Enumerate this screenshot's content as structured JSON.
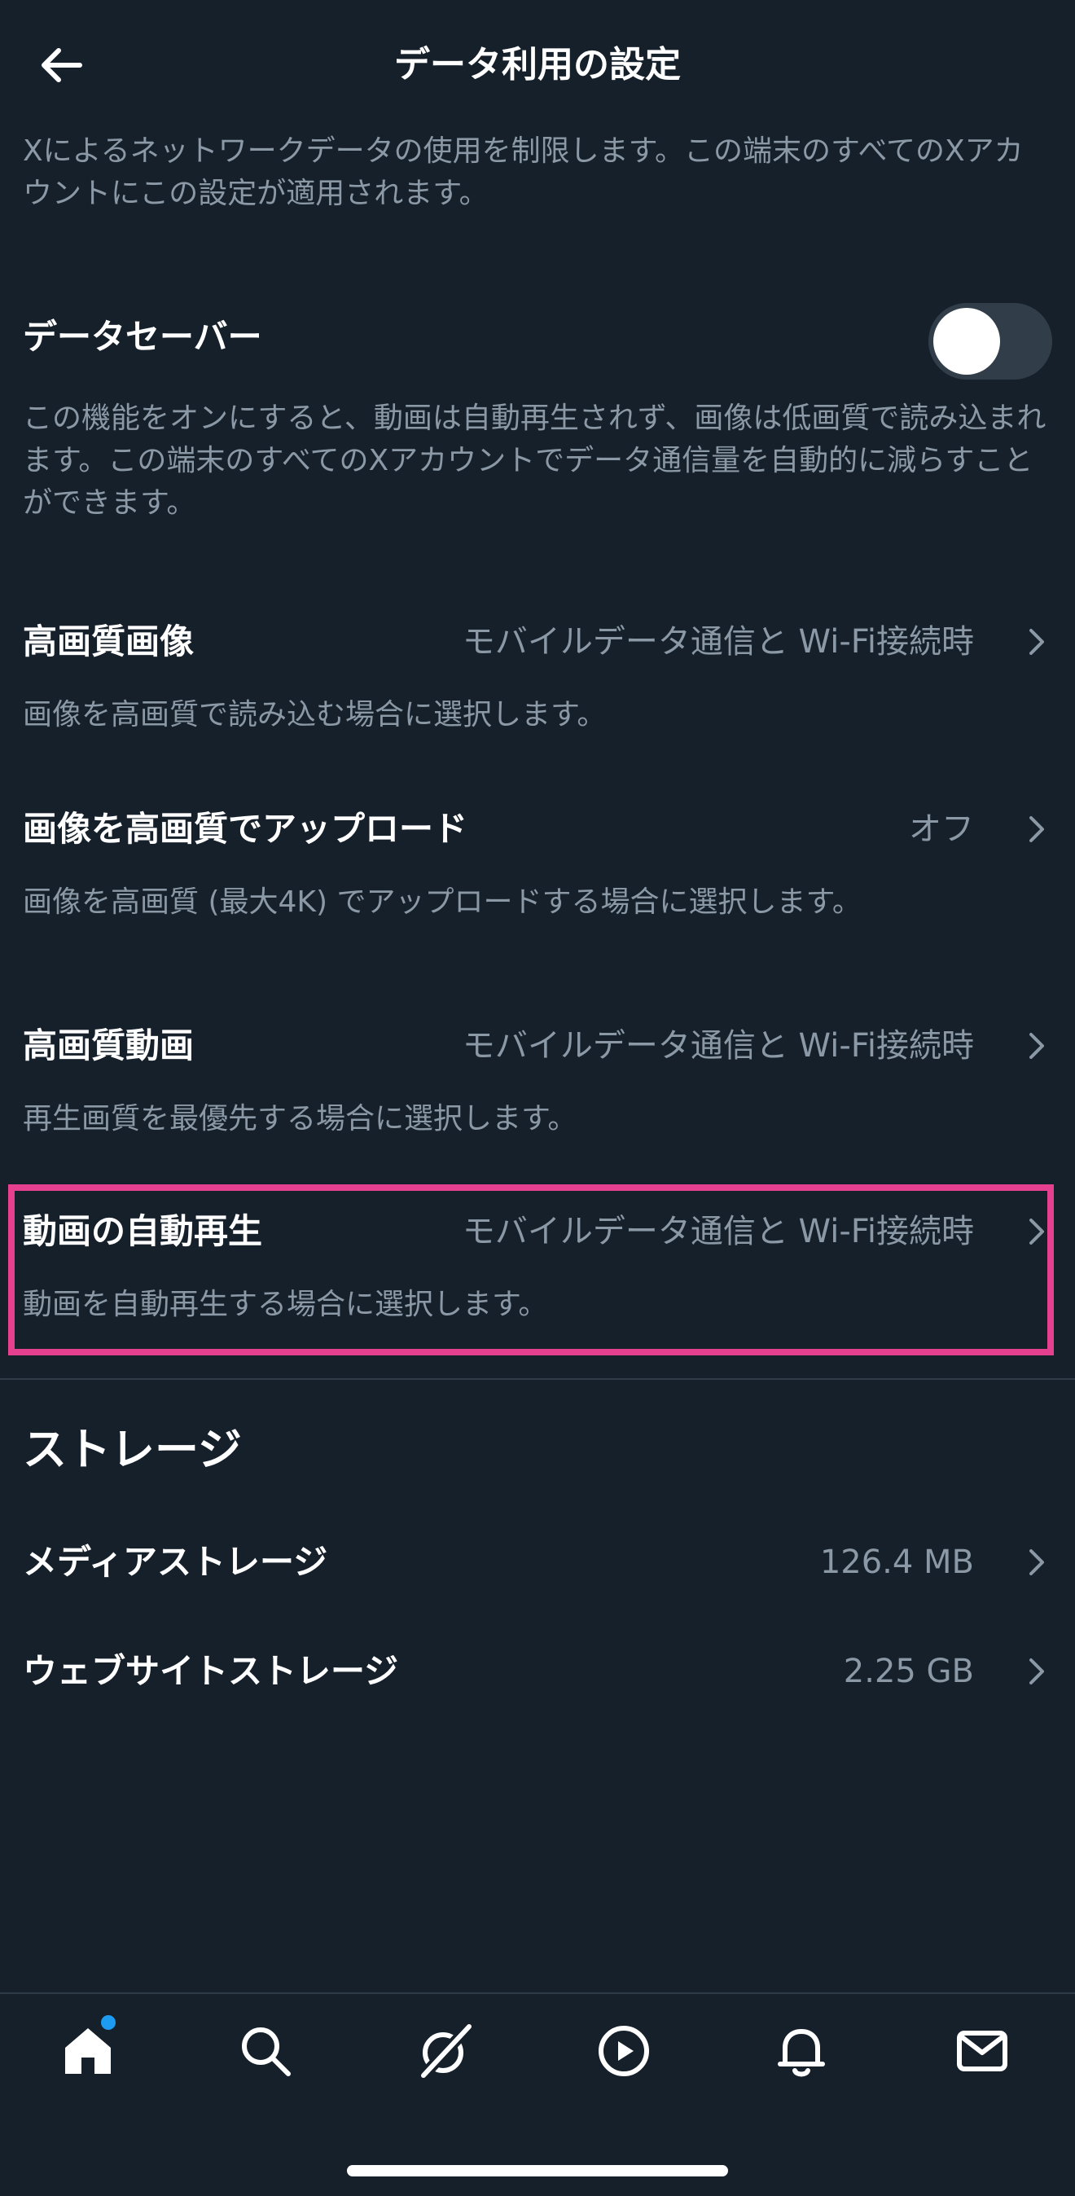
{
  "header": {
    "title": "データ利用の設定"
  },
  "intro": "Xによるネットワークデータの使用を制限します。この端末のすべてのXアカウントにこの設定が適用されます。",
  "data_saver": {
    "label": "データセーバー",
    "enabled": false,
    "description": "この機能をオンにすると、動画は自動再生されず、画像は低画質で読み込まれます。この端末のすべてのXアカウントでデータ通信量を自動的に減らすことができます。"
  },
  "settings": {
    "hq_images": {
      "label": "高画質画像",
      "value": "モバイルデータ通信と Wi-Fi接続時",
      "description": "画像を高画質で読み込む場合に選択します。"
    },
    "hq_upload": {
      "label": "画像を高画質でアップロード",
      "value": "オフ",
      "description": "画像を高画質 (最大4K) でアップロードする場合に選択します。"
    },
    "hq_video": {
      "label": "高画質動画",
      "value": "モバイルデータ通信と Wi-Fi接続時",
      "description": "再生画質を最優先する場合に選択します。"
    },
    "autoplay": {
      "label": "動画の自動再生",
      "value": "モバイルデータ通信と Wi-Fi接続時",
      "description": "動画を自動再生する場合に選択します。"
    }
  },
  "storage": {
    "title": "ストレージ",
    "media": {
      "label": "メディアストレージ",
      "value": "126.4 MB"
    },
    "web": {
      "label": "ウェブサイトストレージ",
      "value": "2.25 GB"
    }
  },
  "nav": {
    "items": [
      "home-icon",
      "search-icon",
      "grok-icon",
      "video-icon",
      "notifications-icon",
      "messages-icon"
    ]
  },
  "colors": {
    "background": "#15202b",
    "highlight": "#e5408f",
    "accent": "#1d9bf0"
  }
}
